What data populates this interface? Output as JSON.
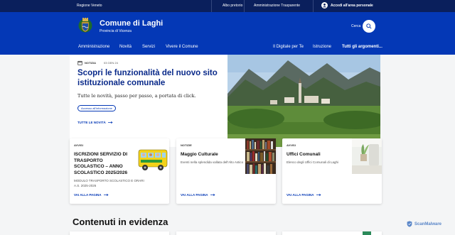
{
  "topbar": {
    "region": "Regione Veneto",
    "links": [
      "Albo pretorio",
      "Amministrazione Trasparente"
    ],
    "login": "Accedi all'area personale"
  },
  "header": {
    "town_name": "Comune di Laghi",
    "province": "Provincia di Vicenza",
    "search_label": "Cerca"
  },
  "nav": {
    "left": [
      "Amministrazione",
      "Novità",
      "Servizi",
      "Vivere il Comune"
    ],
    "right": [
      "Il Digitale per Te",
      "Istruzione",
      "Tutti gli argomenti..."
    ]
  },
  "hero": {
    "kicker": "NOTIZIA",
    "date": "03 GEN 24",
    "title": "Scopri le funzionalità del nuovo sito istituzionale comunale",
    "subtitle": "Tutte le novità, passo per passo, a portata di click.",
    "chip": "Accesso all'informazione",
    "link": "TUTTE LE NOVITÀ"
  },
  "cards": [
    {
      "category": "AVVISI",
      "title": "ISCRIZIONI SERVIZIO DI TRASPORTO SCOLASTICO – ANNO SCOLASTICO 2025/2026",
      "desc": "MODULO TRASPORTO SCOLASTICO E ORARI A.S. 2025-2026",
      "link": "VAI ALLA PAGINA"
    },
    {
      "category": "NOTIZIE",
      "title": "Maggio Culturale",
      "desc": "Eventi nella splendida vallata dell'Alto Astico",
      "link": "VAI ALLA PAGINA"
    },
    {
      "category": "AVVISI",
      "title": "Uffici Comunali",
      "desc": "Elenco degli Uffici Comunali di Laghi",
      "link": "VAI ALLA PAGINA"
    }
  ],
  "featured_title": "Contenuti in evidenza",
  "watermark": "ScanMalware",
  "colors": {
    "primary": "#0438b6",
    "topbar": "#0a1f5c",
    "background": "#f4f5f6"
  }
}
